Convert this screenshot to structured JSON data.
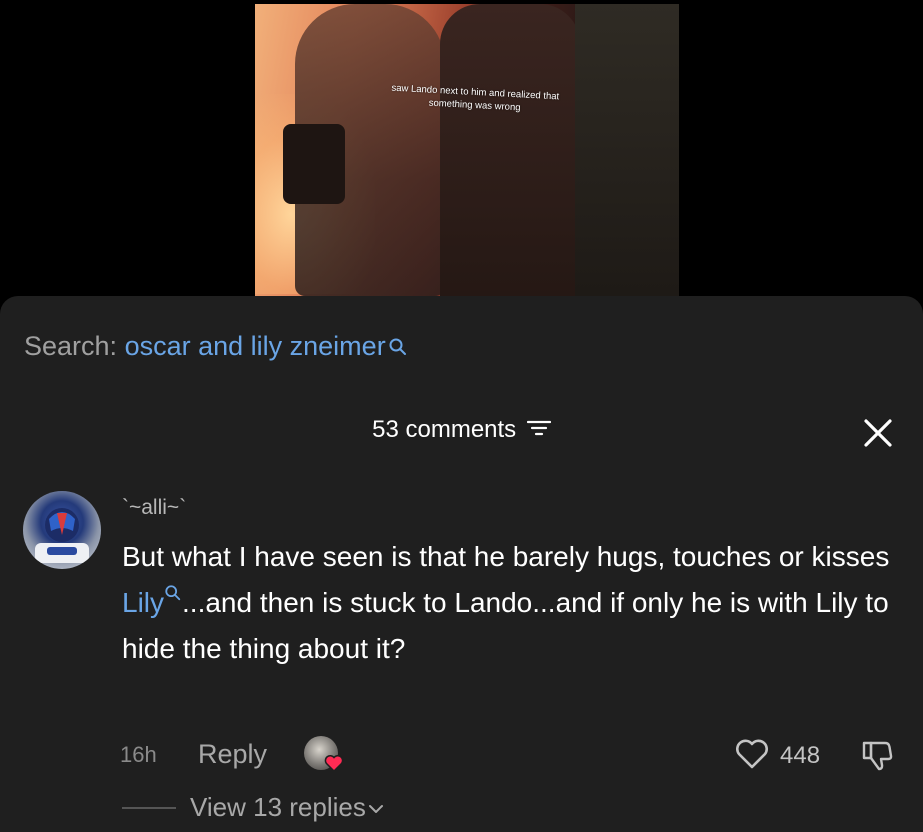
{
  "video": {
    "caption": "saw Lando next to him and realized that something was wrong"
  },
  "search": {
    "label": "Search:",
    "term": "oscar and lily zneimer"
  },
  "comments_panel": {
    "count_label": "53 comments"
  },
  "comment": {
    "username": "`~alli~`",
    "text_before_mention": "But what I have seen is that he barely hugs, touches or kisses ",
    "mention": "Lily",
    "text_after_mention": "...and then is stuck to Lando...and if only he is with Lily to hide the thing about it?",
    "time": "16h",
    "reply_label": "Reply",
    "likes": "448",
    "view_replies_label": "View 13 replies"
  },
  "colors": {
    "sheet_bg": "#1f1f1f",
    "link_blue": "#6aa5e6",
    "creator_heart": "#ff2b54"
  }
}
